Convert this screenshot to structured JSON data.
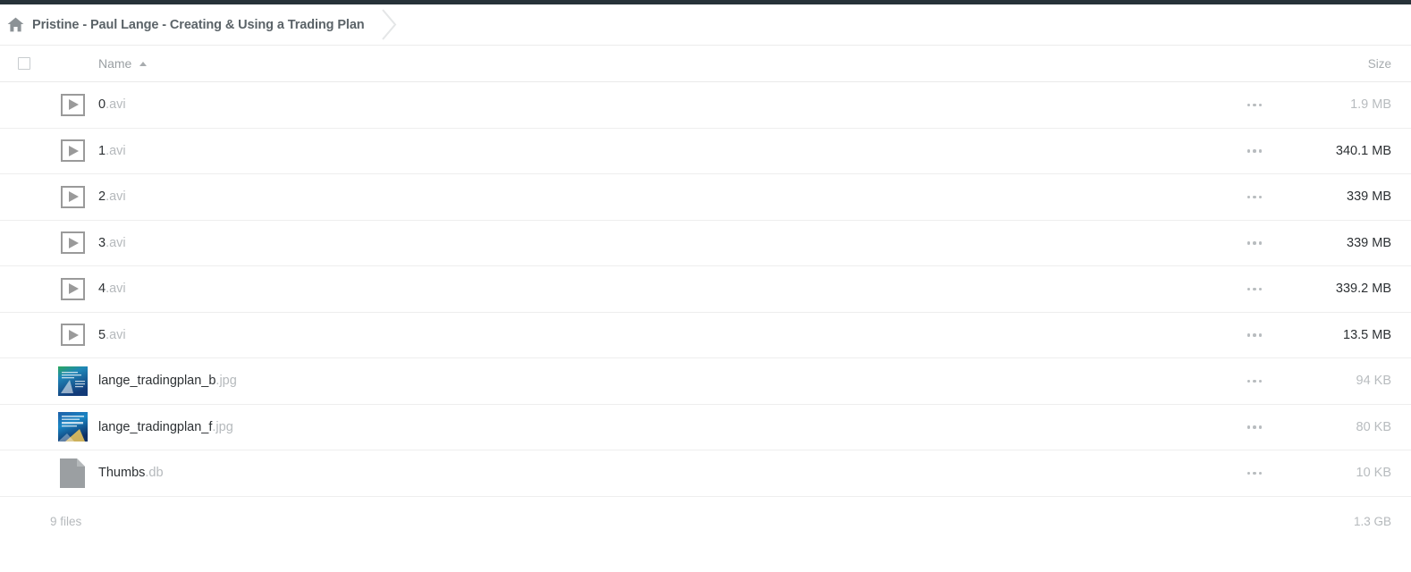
{
  "window": {
    "accent_bar_color": "#273239"
  },
  "breadcrumb": {
    "home_icon": "home-icon",
    "label": "Pristine - Paul Lange - Creating & Using a Trading Plan",
    "separator_icon": "chevron-right-icon"
  },
  "table": {
    "headers": {
      "select_all": "select-all-checkbox",
      "name": "Name",
      "sort_direction": "ascending",
      "size": "Size"
    },
    "rows": [
      {
        "icon": "video-play-icon",
        "basename": "0",
        "ext": ".avi",
        "size": "1.9 MB",
        "size_muted": true,
        "menu": "more-options-icon"
      },
      {
        "icon": "video-play-icon",
        "basename": "1",
        "ext": ".avi",
        "size": "340.1 MB",
        "size_muted": false,
        "menu": "more-options-icon"
      },
      {
        "icon": "video-play-icon",
        "basename": "2",
        "ext": ".avi",
        "size": "339 MB",
        "size_muted": false,
        "menu": "more-options-icon"
      },
      {
        "icon": "video-play-icon",
        "basename": "3",
        "ext": ".avi",
        "size": "339 MB",
        "size_muted": false,
        "menu": "more-options-icon"
      },
      {
        "icon": "video-play-icon",
        "basename": "4",
        "ext": ".avi",
        "size": "339.2 MB",
        "size_muted": false,
        "menu": "more-options-icon"
      },
      {
        "icon": "video-play-icon",
        "basename": "5",
        "ext": ".avi",
        "size": "13.5 MB",
        "size_muted": false,
        "menu": "more-options-icon"
      },
      {
        "icon": "image-thumbnail-b",
        "basename": "lange_tradingplan_b",
        "ext": ".jpg",
        "size": "94 KB",
        "size_muted": true,
        "menu": "more-options-icon"
      },
      {
        "icon": "image-thumbnail-f",
        "basename": "lange_tradingplan_f",
        "ext": ".jpg",
        "size": "80 KB",
        "size_muted": true,
        "menu": "more-options-icon"
      },
      {
        "icon": "generic-file-icon",
        "basename": "Thumbs",
        "ext": ".db",
        "size": "10 KB",
        "size_muted": true,
        "menu": "more-options-icon"
      }
    ]
  },
  "footer": {
    "file_count": "9 files",
    "total_size": "1.3 GB"
  }
}
